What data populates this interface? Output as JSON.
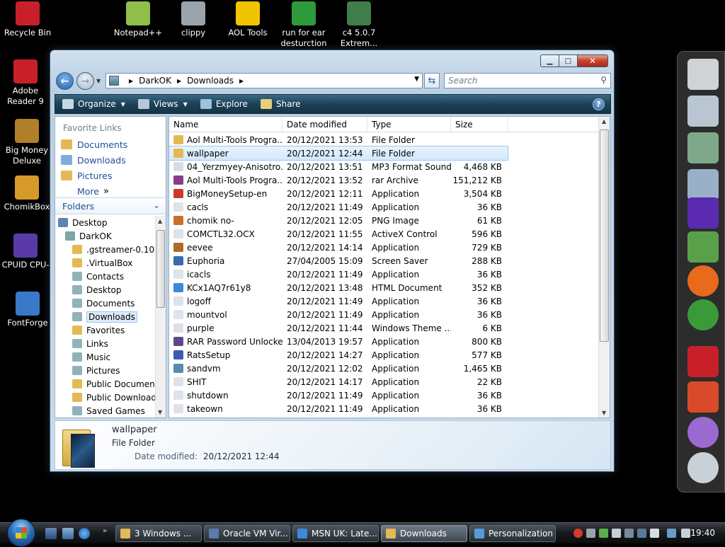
{
  "desktop_icons": [
    {
      "label": "Recycle Bin",
      "color": "#c8202a"
    },
    {
      "label": "Notepad++",
      "color": "#8fbf4a"
    },
    {
      "label": "clippy",
      "color": "#9aa4ad"
    },
    {
      "label": "AOL Tools",
      "color": "#f1c400"
    },
    {
      "label": "run for ear desturction",
      "color": "#2e9b3a"
    },
    {
      "label": "c4 5.0.7 Extrem...",
      "color": "#3f7d4a"
    },
    {
      "label": "Adobe Reader 9",
      "color": "#c8202a"
    },
    {
      "label": "Big Money Deluxe",
      "color": "#b07f2a"
    },
    {
      "label": "ChomikBox",
      "color": "#d69a2a"
    },
    {
      "label": "CPUID CPU-",
      "color": "#5a3aa8"
    },
    {
      "label": "FontForge",
      "color": "#3a78c8"
    }
  ],
  "window": {
    "caption_buttons": {
      "minimize": "▁",
      "maximize": "□",
      "close": "✕"
    },
    "nav": {
      "back": "←",
      "forward": "→"
    },
    "breadcrumb": [
      "DarkOK",
      "Downloads"
    ],
    "search_placeholder": "Search",
    "commands": [
      {
        "label": "Organize",
        "has_menu": true,
        "icon_color": "#c6d7e6"
      },
      {
        "label": "Views",
        "has_menu": true,
        "icon_color": "#b7c8d8"
      },
      {
        "label": "Explore",
        "has_menu": false,
        "icon_color": "#9dc2e0"
      },
      {
        "label": "Share",
        "has_menu": false,
        "icon_color": "#e7cf7a"
      }
    ],
    "help_label": "?",
    "favorite_links_title": "Favorite Links",
    "favorite_links": [
      {
        "label": "Documents",
        "icon_color": "#e4b953"
      },
      {
        "label": "Downloads",
        "icon_color": "#7bb0d8"
      },
      {
        "label": "Pictures",
        "icon_color": "#e4b953"
      }
    ],
    "more_label": "More",
    "folders_label": "Folders",
    "tree": [
      {
        "label": "Desktop",
        "indent": 0,
        "icon_color": "#5b86b0"
      },
      {
        "label": "DarkOK",
        "indent": 1,
        "icon_color": "#7fa3a8"
      },
      {
        "label": ".gstreamer-0.10",
        "indent": 2,
        "icon_color": "#e4b953"
      },
      {
        "label": ".VirtualBox",
        "indent": 2,
        "icon_color": "#e4b953"
      },
      {
        "label": "Contacts",
        "indent": 2,
        "icon_color": "#8fb3b8"
      },
      {
        "label": "Desktop",
        "indent": 2,
        "icon_color": "#8fb3b8"
      },
      {
        "label": "Documents",
        "indent": 2,
        "icon_color": "#8fb3b8"
      },
      {
        "label": "Downloads",
        "indent": 2,
        "icon_color": "#8fb3b8",
        "selected": true
      },
      {
        "label": "Favorites",
        "indent": 2,
        "icon_color": "#e4b953"
      },
      {
        "label": "Links",
        "indent": 2,
        "icon_color": "#8fb3b8"
      },
      {
        "label": "Music",
        "indent": 2,
        "icon_color": "#8fb3b8"
      },
      {
        "label": "Pictures",
        "indent": 2,
        "icon_color": "#8fb3b8"
      },
      {
        "label": "Public Documents",
        "indent": 2,
        "icon_color": "#e4b953"
      },
      {
        "label": "Public Downloads",
        "indent": 2,
        "icon_color": "#e4b953"
      },
      {
        "label": "Saved Games",
        "indent": 2,
        "icon_color": "#8fb3b8"
      }
    ],
    "columns": {
      "name": "Name",
      "date": "Date modified",
      "type": "Type",
      "size": "Size"
    },
    "files": [
      {
        "name": "Aol Multi-Tools Progra...",
        "date": "20/12/2021 13:53",
        "type": "File Folder",
        "size": "",
        "icon_color": "#e4b953"
      },
      {
        "name": "wallpaper",
        "date": "20/12/2021 12:44",
        "type": "File Folder",
        "size": "",
        "icon_color": "#e4b953",
        "selected": true
      },
      {
        "name": "04_Yerzmyey-Anisotro...",
        "date": "20/12/2021 13:51",
        "type": "MP3 Format Sound",
        "size": "4,468 KB",
        "icon_color": "#d8dde2"
      },
      {
        "name": "Aol Multi-Tools Progra...",
        "date": "20/12/2021 13:52",
        "type": "rar Archive",
        "size": "151,212 KB",
        "icon_color": "#8a3a8a"
      },
      {
        "name": "BigMoneySetup-en",
        "date": "20/12/2021 12:11",
        "type": "Application",
        "size": "3,504 KB",
        "icon_color": "#c83a2a"
      },
      {
        "name": "cacls",
        "date": "20/12/2021 11:49",
        "type": "Application",
        "size": "36 KB",
        "icon_color": "#dde3e8"
      },
      {
        "name": "chomik no-",
        "date": "20/12/2021 12:05",
        "type": "PNG Image",
        "size": "61 KB",
        "icon_color": "#c8702a"
      },
      {
        "name": "COMCTL32.OCX",
        "date": "20/12/2021 11:55",
        "type": "ActiveX Control",
        "size": "596 KB",
        "icon_color": "#dde3e8"
      },
      {
        "name": "eevee",
        "date": "20/12/2021 14:14",
        "type": "Application",
        "size": "729 KB",
        "icon_color": "#b06a2a"
      },
      {
        "name": "Euphoria",
        "date": "27/04/2005 15:09",
        "type": "Screen Saver",
        "size": "288 KB",
        "icon_color": "#3a6ab0"
      },
      {
        "name": "icacls",
        "date": "20/12/2021 11:49",
        "type": "Application",
        "size": "36 KB",
        "icon_color": "#dde3e8"
      },
      {
        "name": "KCx1AQ7r61y8",
        "date": "20/12/2021 13:48",
        "type": "HTML Document",
        "size": "352 KB",
        "icon_color": "#3a8ad8"
      },
      {
        "name": "logoff",
        "date": "20/12/2021 11:49",
        "type": "Application",
        "size": "36 KB",
        "icon_color": "#dde3e8"
      },
      {
        "name": "mountvol",
        "date": "20/12/2021 11:49",
        "type": "Application",
        "size": "36 KB",
        "icon_color": "#dde3e8"
      },
      {
        "name": "purple",
        "date": "20/12/2021 11:44",
        "type": "Windows Theme ...",
        "size": "6 KB",
        "icon_color": "#dde3e8"
      },
      {
        "name": "RAR Password Unlocker",
        "date": "13/04/2013 19:57",
        "type": "Application",
        "size": "800 KB",
        "icon_color": "#5a4a8a"
      },
      {
        "name": "RatsSetup",
        "date": "20/12/2021 14:27",
        "type": "Application",
        "size": "577 KB",
        "icon_color": "#3a5ab0"
      },
      {
        "name": "sandvm",
        "date": "20/12/2021 12:02",
        "type": "Application",
        "size": "1,465 KB",
        "icon_color": "#5a8ab0"
      },
      {
        "name": "SHIT",
        "date": "20/12/2021 14:17",
        "type": "Application",
        "size": "22 KB",
        "icon_color": "#dde3e8"
      },
      {
        "name": "shutdown",
        "date": "20/12/2021 11:49",
        "type": "Application",
        "size": "36 KB",
        "icon_color": "#dde3e8"
      },
      {
        "name": "takeown",
        "date": "20/12/2021 11:49",
        "type": "Application",
        "size": "36 KB",
        "icon_color": "#dde3e8"
      }
    ],
    "details": {
      "name": "wallpaper",
      "type": "File Folder",
      "date_label": "Date modified:",
      "date_value": "20/12/2021 12:44"
    }
  },
  "sidebar_gadgets": [
    {
      "name": "notepad-gadget",
      "color": "#cfd3d6"
    },
    {
      "name": "documents-gadget",
      "color": "#b9c6d2"
    },
    {
      "name": "folder-gadget",
      "color": "#7fa88a"
    },
    {
      "name": "ftp-gadget",
      "color": "#9ab0c8"
    },
    {
      "name": "cpu-gadget",
      "color": "#5a2ab0"
    },
    {
      "name": "contacts-gadget",
      "color": "#5aa04a"
    },
    {
      "name": "firefox-gadget",
      "color": "#e86a1a"
    },
    {
      "name": "chrome-gadget",
      "color": "#3a9a3a"
    },
    {
      "name": "acrobat-gadget",
      "color": "#c8202a"
    },
    {
      "name": "paint-gadget",
      "color": "#d84a2a"
    },
    {
      "name": "pen-gadget",
      "color": "#9a6ad0"
    },
    {
      "name": "recycle-gadget",
      "color": "#c8d0d8"
    }
  ],
  "taskbar": {
    "tasks": [
      {
        "label": "3 Windows ...",
        "icon_color": "#e4b953",
        "active": false
      },
      {
        "label": "Oracle VM Vir...",
        "icon_color": "#5a7ab0",
        "active": false
      },
      {
        "label": "MSN UK: Late...",
        "icon_color": "#3a8ad8",
        "active": false
      },
      {
        "label": "Downloads",
        "icon_color": "#e4b953",
        "active": true
      },
      {
        "label": "Personalization",
        "icon_color": "#5a9ad8",
        "active": false
      }
    ],
    "clock": "19:40"
  }
}
